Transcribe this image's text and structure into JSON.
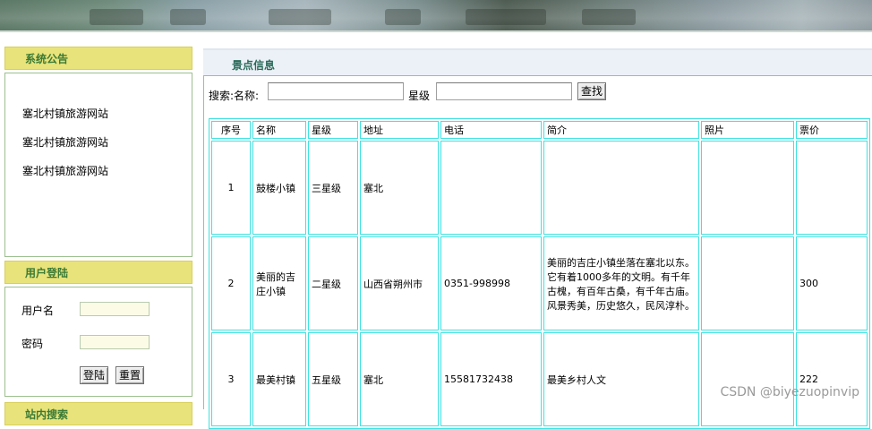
{
  "notice": {
    "title": "系统公告",
    "items": [
      "塞北村镇旅游网站",
      "塞北村镇旅游网站",
      "塞北村镇旅游网站"
    ]
  },
  "login": {
    "title": "用户登陆",
    "username_label": "用户名",
    "password_label": "密码",
    "login_button": "登陆",
    "reset_button": "重置"
  },
  "third_panel": {
    "title": "站内搜索"
  },
  "main": {
    "title": "景点信息",
    "search_label": "搜索:名称:",
    "level_label": "星级",
    "search_button": "查找"
  },
  "table": {
    "headers": [
      "序号",
      "名称",
      "星级",
      "地址",
      "电话",
      "简介",
      "照片",
      "票价"
    ],
    "rows": [
      {
        "idx": "1",
        "name": "鼓楼小镇",
        "level": "三星级",
        "address": "塞北",
        "phone": "",
        "intro": "",
        "photo": "",
        "price": ""
      },
      {
        "idx": "2",
        "name": "美丽的吉庄小镇",
        "level": "二星级",
        "address": "山西省朔州市",
        "phone": "0351-998998",
        "intro": "美丽的吉庄小镇坐落在塞北以东。它有着1000多年的文明。有千年古槐，有百年古桑，有千年古庙。风景秀美，历史悠久，民风淳朴。",
        "photo": "",
        "price": "300"
      },
      {
        "idx": "3",
        "name": "最美村镇",
        "level": "五星级",
        "address": "塞北",
        "phone": "15581732438",
        "intro": "最美乡村人文",
        "photo": "",
        "price": "222"
      }
    ]
  },
  "watermark": "CSDN @biyezuopinvip"
}
